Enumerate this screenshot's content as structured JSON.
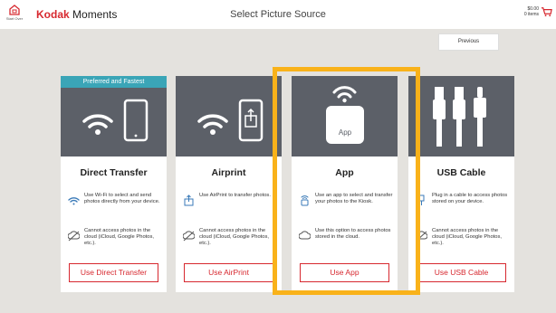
{
  "header": {
    "home_label": "Start Over",
    "brand": "Kodak",
    "brand_suffix": " Moments",
    "title": "Select Picture Source",
    "cart_price": "$0.00",
    "cart_items": "0 items"
  },
  "previous_label": "Previous",
  "colors": {
    "accent": "#d7282f",
    "highlight": "#f9b21a",
    "ribbon": "#3aa5b7",
    "hero": "#5c6068"
  },
  "cards": [
    {
      "ribbon": "Preferred and Fastest",
      "title": "Direct Transfer",
      "feature1": "Use Wi-Fi to select and send photos directly from your device.",
      "feature2": "Cannot access photos in the cloud (iCloud, Google Photos, etc.).",
      "button": "Use Direct Transfer"
    },
    {
      "title": "Airprint",
      "feature1": "Use AirPrint to transfer photos.",
      "feature2": "Cannot access photos in the cloud (iCloud, Google Photos, etc.).",
      "button": "Use AirPrint"
    },
    {
      "app_badge": "App",
      "title": "App",
      "feature1": "Use an app to select and transfer your photos to the Kiosk.",
      "feature2": "Use this option to access photos stored in the cloud.",
      "button": "Use App"
    },
    {
      "title": "USB Cable",
      "feature1": "Plug in a cable to access photos stored on your device.",
      "feature2": "Cannot access photos in the cloud (iCloud, Google Photos, etc.).",
      "button": "Use USB Cable"
    }
  ]
}
